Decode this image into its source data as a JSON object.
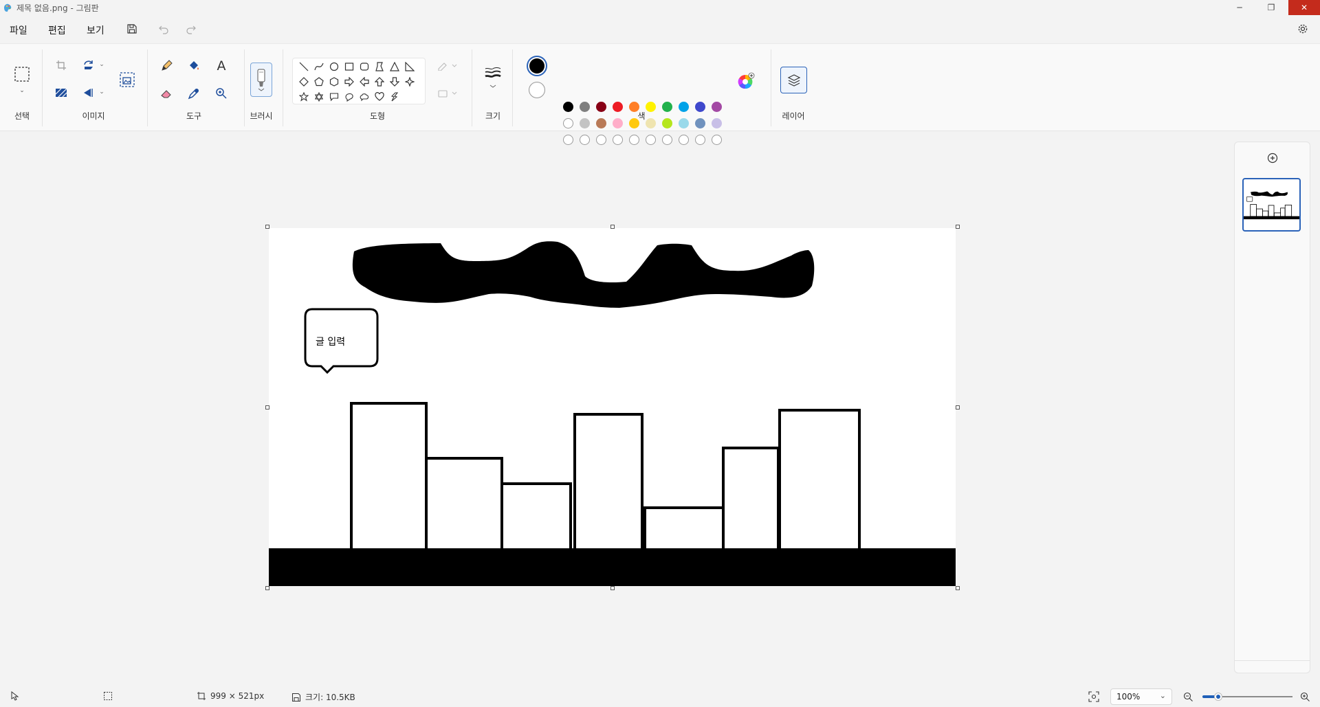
{
  "window": {
    "title": "제목 없음.png - 그림판",
    "minimize": "─",
    "restore": "❐",
    "close": "✕"
  },
  "menu": {
    "file": "파일",
    "edit": "편집",
    "view": "보기"
  },
  "ribbon": {
    "groups": {
      "selection": "선택",
      "image": "이미지",
      "tools": "도구",
      "brush": "브러시",
      "shapes": "도형",
      "size": "크기",
      "colors": "색",
      "layers": "레이어"
    },
    "primary_color": "#000000",
    "secondary_color": "#ffffff",
    "palette_row1": [
      "#000000",
      "#7f7f7f",
      "#880015",
      "#ed1c24",
      "#ff7f27",
      "#fff200",
      "#22b14c",
      "#00a2e8",
      "#3f48cc",
      "#a349a4"
    ],
    "palette_row2": [
      "#ffffff",
      "#c3c3c3",
      "#b97a57",
      "#ffaec9",
      "#ffc90e",
      "#efe4b0",
      "#b5e61d",
      "#99d9ea",
      "#7092be",
      "#c8bfe7"
    ],
    "palette_row3_empty_count": 10
  },
  "canvas": {
    "callout_text": "글 입력"
  },
  "status": {
    "dimensions": "999 × 521px",
    "file_size": "크기: 10.5KB",
    "zoom": "100%"
  }
}
